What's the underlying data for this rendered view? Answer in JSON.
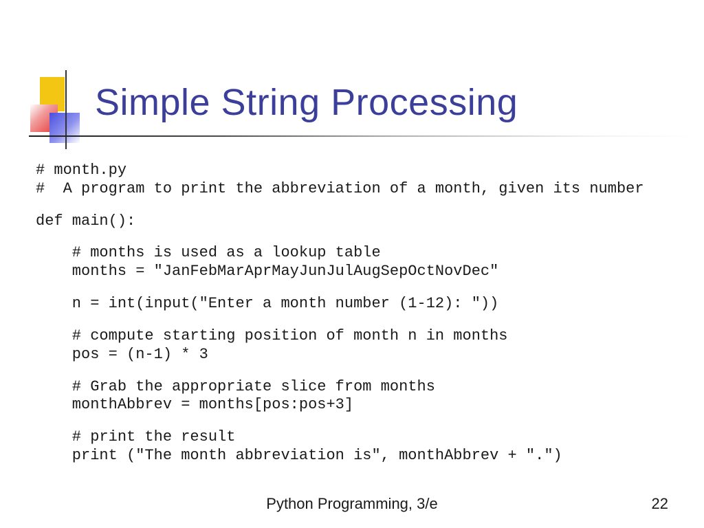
{
  "title": "Simple String Processing",
  "code": {
    "b1": "# month.py\n#  A program to print the abbreviation of a month, given its number",
    "b2": "def main():",
    "b3": "    # months is used as a lookup table\n    months = \"JanFebMarAprMayJunJulAugSepOctNovDec\"",
    "b4": "    n = int(input(\"Enter a month number (1-12): \"))",
    "b5": "    # compute starting position of month n in months\n    pos = (n-1) * 3",
    "b6": "    # Grab the appropriate slice from months\n    monthAbbrev = months[pos:pos+3]",
    "b7": "    # print the result\n    print (\"The month abbreviation is\", monthAbbrev + \".\")"
  },
  "footer": "Python Programming, 3/e",
  "page_number": "22"
}
